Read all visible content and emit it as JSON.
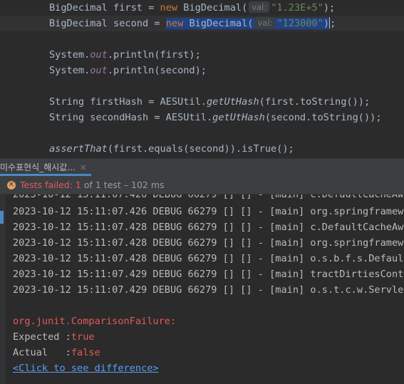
{
  "editor": {
    "line1": {
      "type": "BigDecimal",
      "name": "first",
      "eq": "=",
      "new": "new",
      "ctor": "BigDecimal(",
      "hint": "val:",
      "arg": "\"1.23E+5\"",
      "end": ");"
    },
    "line2": {
      "type": "BigDecimal",
      "name": "second",
      "eq": "=",
      "new": "new",
      "ctor": "BigDecimal(",
      "hint": "val:",
      "arg": "\"123000\"",
      "close": ")",
      "semi": ";"
    },
    "line3": {
      "pre": "System.",
      "field": "out",
      "post": ".println(first);"
    },
    "line4": {
      "pre": "System.",
      "field": "out",
      "post": ".println(second);"
    },
    "line5": {
      "pre": "String firstHash = AESUtil.",
      "method": "getUtHash",
      "post": "(first.toString());"
    },
    "line6": {
      "pre": "String secondHash = AESUtil.",
      "method": "getUtHash",
      "post": "(second.toString());"
    },
    "line7": {
      "method": "assertThat",
      "post": "(first.equals(second)).isTrue();"
    }
  },
  "tab": {
    "label": "미수표현식_해시값...",
    "close": "×"
  },
  "status": {
    "prefix": "Tests failed: ",
    "count": "1",
    "suffix": " of 1 test – 102 ms"
  },
  "console": {
    "logs": [
      "2023-10-12 15:11:07.426 DEBUG 66279 [] [] - [main] c.DefaultCacheAwar",
      "2023-10-12 15:11:07.426 DEBUG 66279 [] [] - [main] org.springframewor",
      "2023-10-12 15:11:07.428 DEBUG 66279 [] [] - [main] c.DefaultCacheAwar",
      "2023-10-12 15:11:07.428 DEBUG 66279 [] [] - [main] org.springframewor",
      "2023-10-12 15:11:07.428 DEBUG 66279 [] [] - [main] o.s.b.f.s.DefaultL",
      "2023-10-12 15:11:07.429 DEBUG 66279 [] [] - [main] tractDirtiesContex",
      "2023-10-12 15:11:07.429 DEBUG 66279 [] [] - [main] o.s.t.c.w.ServletT"
    ],
    "failure": "org.junit.ComparisonFailure:",
    "expected_label": "Expected :",
    "expected_value": "true",
    "actual_label": "Actual   :",
    "actual_value": "false",
    "diff_link": "<Click to see difference>"
  },
  "colors": {
    "keyword": "#cc7832",
    "string": "#6a8759",
    "field": "#9876aa",
    "error": "#e35a5a",
    "link": "#589df6",
    "selection": "#214283"
  }
}
